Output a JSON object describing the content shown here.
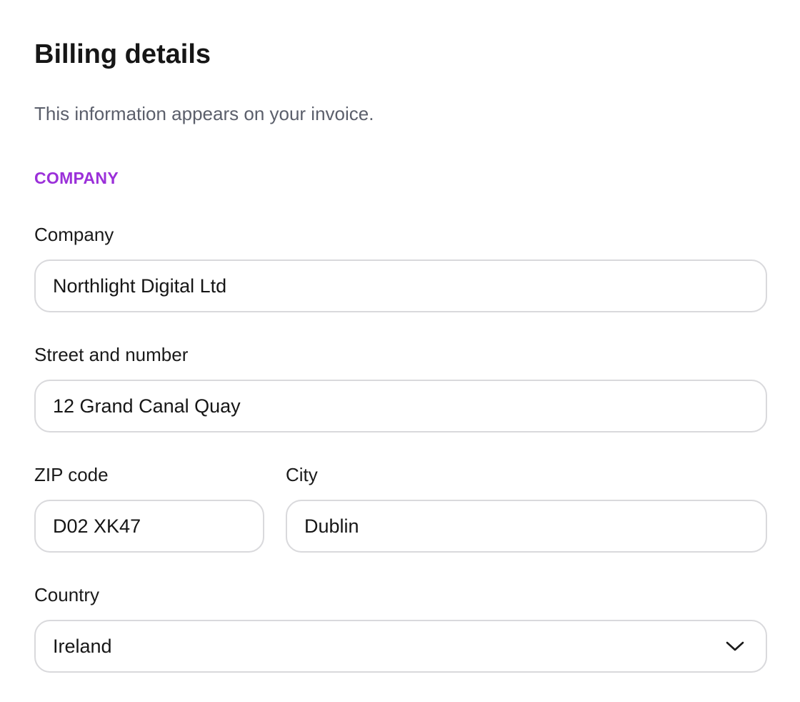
{
  "header": {
    "title": "Billing details",
    "subtitle": "This information appears on your invoice."
  },
  "section": {
    "label": "COMPANY",
    "color": "#9b30d9"
  },
  "fields": {
    "company": {
      "label": "Company",
      "value": "Northlight Digital Ltd"
    },
    "street": {
      "label": "Street and number",
      "value": "12 Grand Canal Quay"
    },
    "zip": {
      "label": "ZIP code",
      "value": "D02 XK47"
    },
    "city": {
      "label": "City",
      "value": "Dublin"
    },
    "country": {
      "label": "Country",
      "value": "Ireland",
      "icon": "chevron-down-icon"
    }
  },
  "colors": {
    "text": "#161616",
    "muted": "#5b5f6b",
    "border": "#d9d9dc",
    "accent": "#9b30d9"
  }
}
